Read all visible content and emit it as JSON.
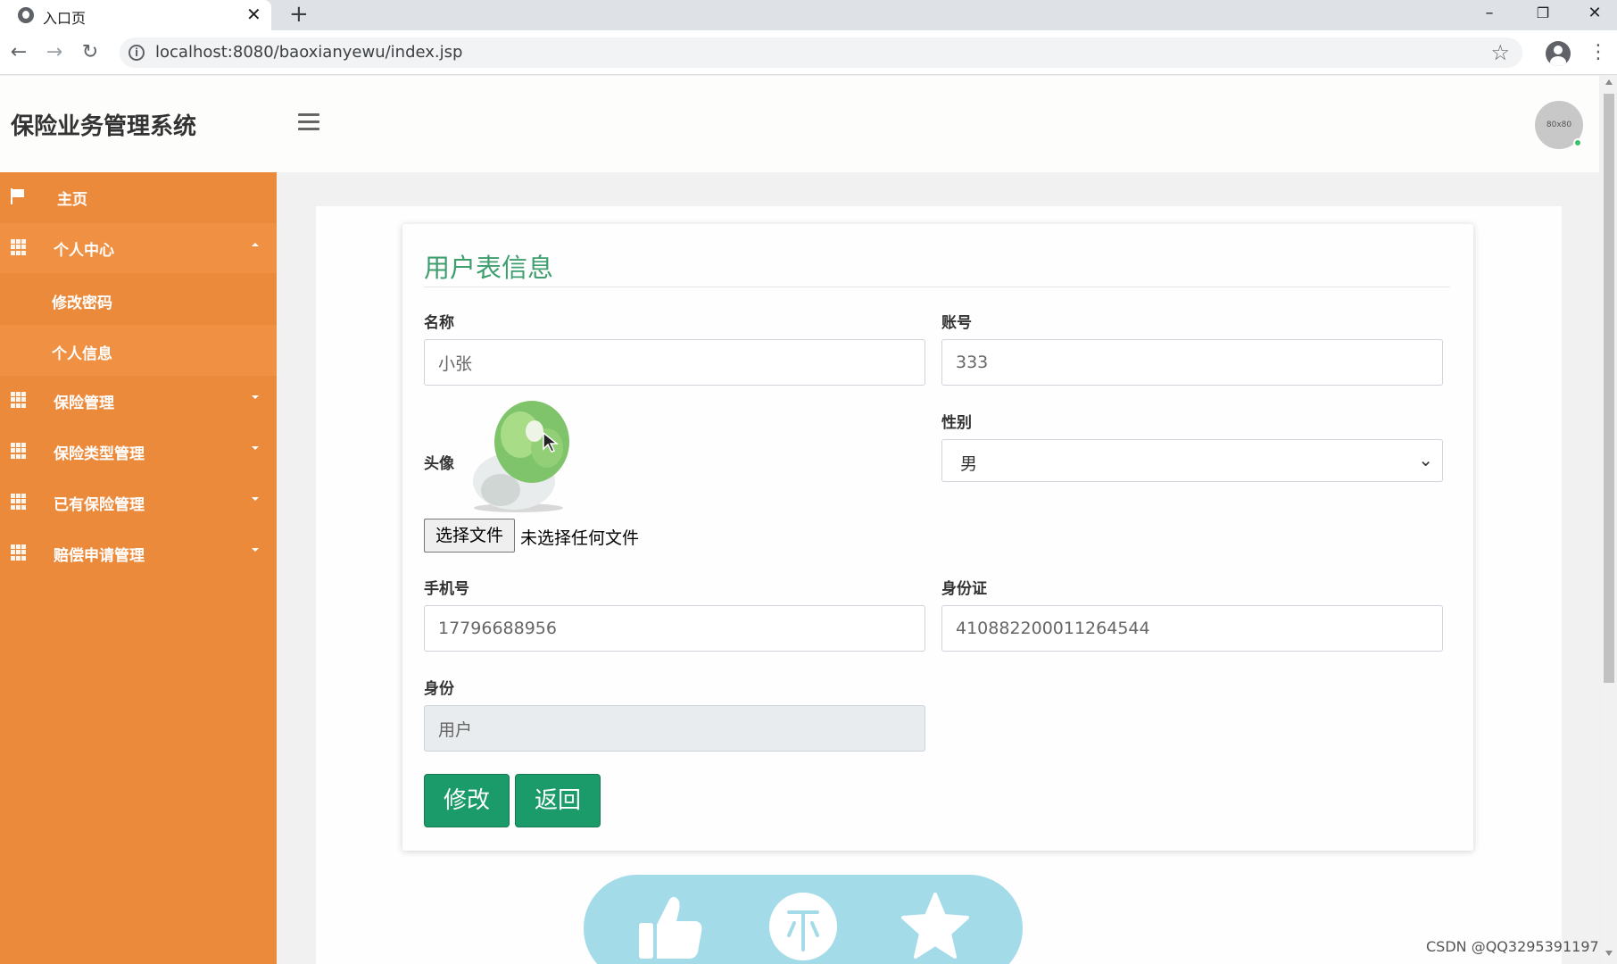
{
  "browser": {
    "tab_title": "入口页",
    "tab_close": "✕",
    "new_tab": "+",
    "url": "localhost:8080/baoxianyewu/index.jsp",
    "window_controls": {
      "minimize": "–",
      "restore": "❐",
      "close": "✕"
    }
  },
  "header": {
    "brand": "保险业务管理系统",
    "avatar_text": "80x80"
  },
  "sidebar": {
    "items": [
      {
        "label": "主页"
      },
      {
        "label": "个人中心"
      },
      {
        "label": "修改密码"
      },
      {
        "label": "个人信息"
      },
      {
        "label": "保险管理"
      },
      {
        "label": "保险类型管理"
      },
      {
        "label": "已有保险管理"
      },
      {
        "label": "赔偿申请管理"
      }
    ]
  },
  "form": {
    "title": "用户表信息",
    "name_label": "名称",
    "name_value": "小张",
    "account_label": "账号",
    "account_value": "333",
    "avatar_label": "头像",
    "gender_label": "性别",
    "gender_value": "男",
    "file_button": "选择文件",
    "file_status": "未选择任何文件",
    "phone_label": "手机号",
    "phone_value": "17796688956",
    "idcard_label": "身份证",
    "idcard_value": "410882200011264544",
    "role_label": "身份",
    "role_value": "用户",
    "edit_button": "修改",
    "back_button": "返回"
  },
  "watermark": "CSDN @QQ3295391197",
  "colors": {
    "sidebar": "#ec8a3c",
    "accent_green": "#1b9a6a",
    "title_green": "#3f9e6e",
    "reaction_bar": "#a4dbe9"
  },
  "icons": [
    "flag-icon",
    "grid-icon",
    "thumbs-up-icon",
    "coin-icon",
    "star-icon"
  ]
}
